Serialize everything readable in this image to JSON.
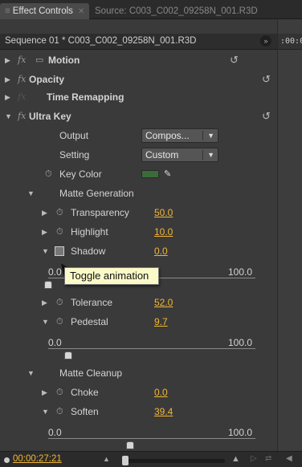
{
  "tabs": {
    "active_label": "Effect Controls",
    "inactive_label": "Source: C003_C002_09258N_001.R3D"
  },
  "header": {
    "sequence": "Sequence 01 * C003_C002_09258N_001.R3D"
  },
  "timeline": {
    "ruler_text": ":00:0"
  },
  "effects": {
    "motion": "Motion",
    "opacity": "Opacity",
    "time_remapping": "Time Remapping",
    "ultra_key": "Ultra Key",
    "fx_symbol": "fx"
  },
  "ultra_key": {
    "output_label": "Output",
    "output_value": "Compos...",
    "setting_label": "Setting",
    "setting_value": "Custom",
    "key_color_label": "Key Color",
    "key_color_hex": "#3c6b3a"
  },
  "matte_generation": {
    "label": "Matte Generation",
    "transparency_label": "Transparency",
    "transparency_value": "50.0",
    "highlight_label": "Highlight",
    "highlight_value": "10.0",
    "shadow_label": "Shadow",
    "shadow_value": "0.0",
    "shadow_min": "0.0",
    "shadow_max": "100.0",
    "shadow_level": 0.0,
    "tolerance_label": "Tolerance",
    "tolerance_value": "52.0",
    "pedestal_label": "Pedestal",
    "pedestal_value": "9.7",
    "pedestal_min": "0.0",
    "pedestal_max": "100.0",
    "pedestal_level": 9.7
  },
  "matte_cleanup": {
    "label": "Matte Cleanup",
    "choke_label": "Choke",
    "choke_value": "0.0",
    "soften_label": "Soften",
    "soften_value": "39.4",
    "soften_min": "0.0",
    "soften_max": "100.0",
    "soften_level": 39.4
  },
  "tooltip": "Toggle animation",
  "footer": {
    "timecode": "00:00:27:21"
  },
  "colors": {
    "value_accent": "#f2b634",
    "panel_bg": "#3a3a3a"
  }
}
